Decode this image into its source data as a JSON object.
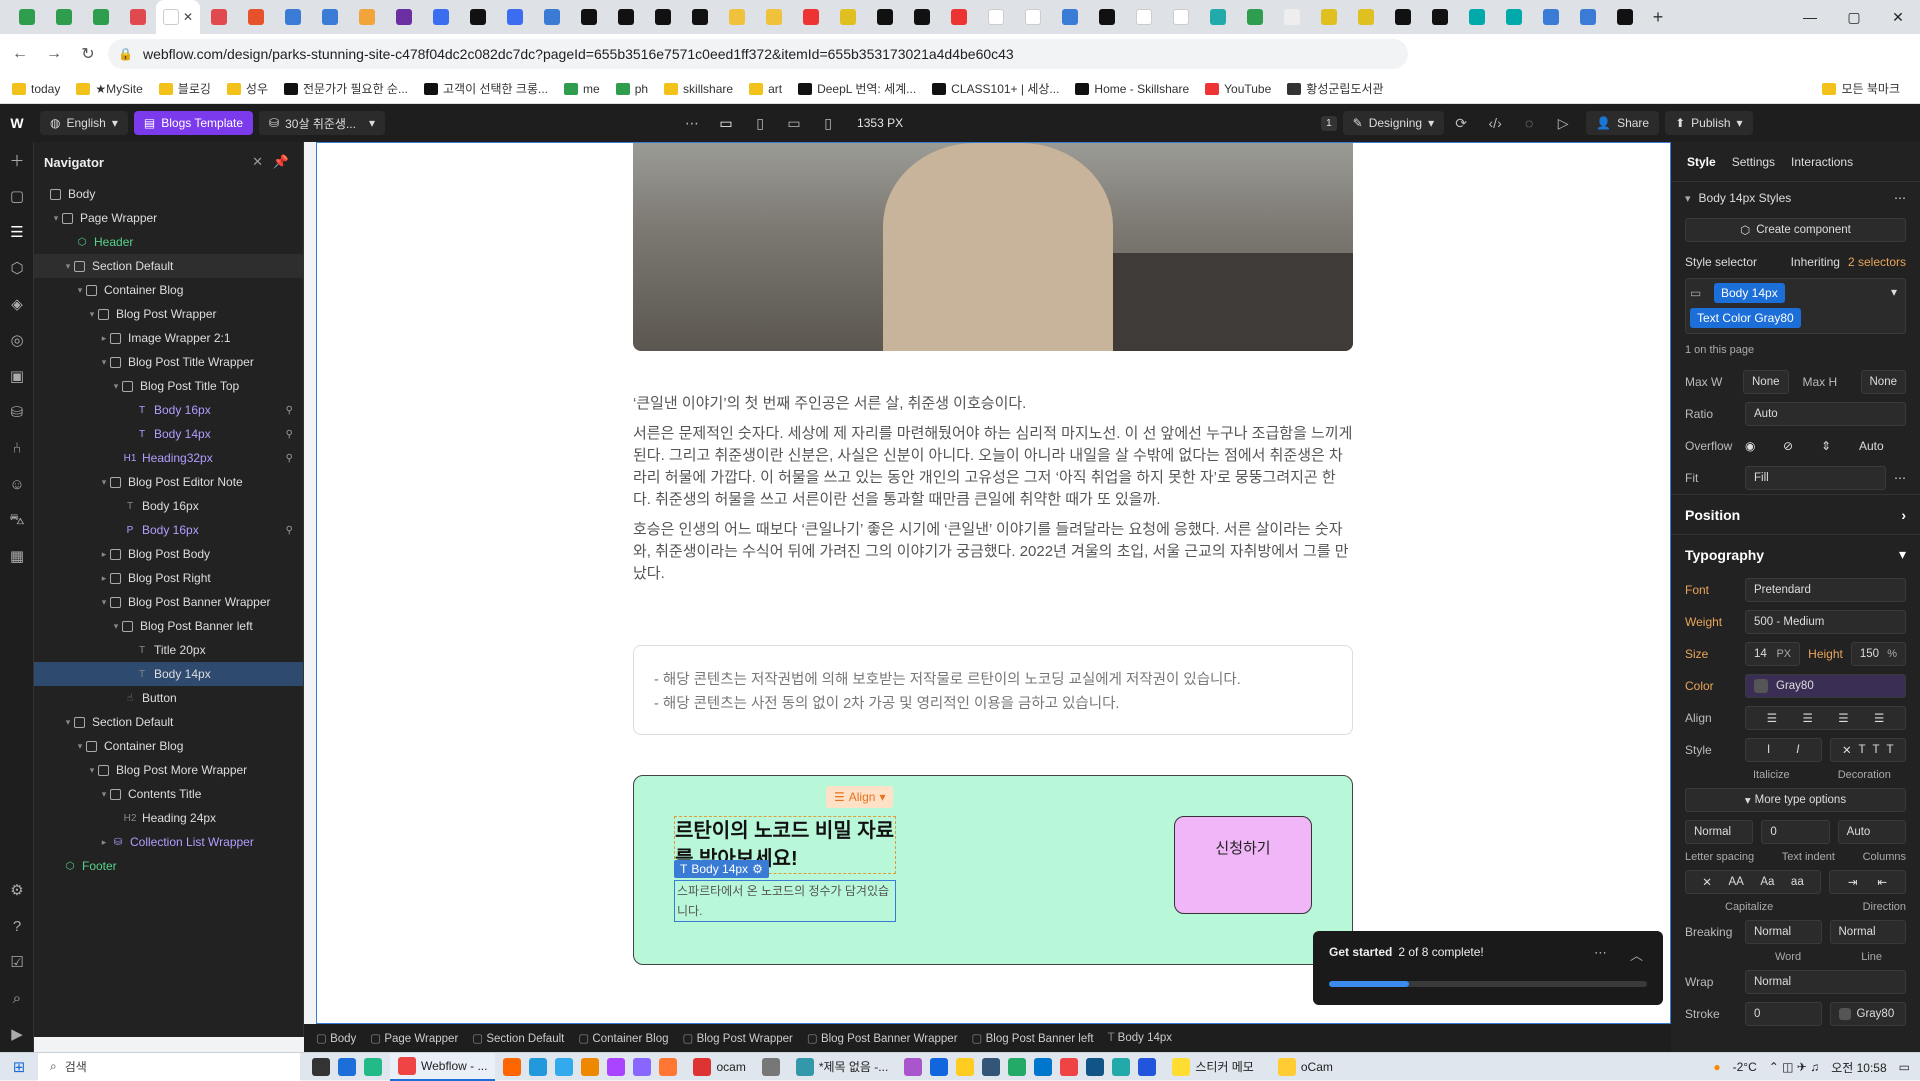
{
  "browser": {
    "active_tab_close": "✕",
    "new_tab": "+",
    "url": "webflow.com/design/parks-stunning-site-c478f04dc2c082dc7dc?pageId=655b3516e7571c0eed1ff372&itemId=655b353173021a4d4be60c43",
    "bookmarks": [
      "today",
      "★MySite",
      "블로깅",
      "성우",
      "전문가가 필요한 순...",
      "고객이 선택한 크롱...",
      "me",
      "ph",
      "skillshare",
      "art",
      "DeepL 번역: 세계...",
      "CLASS101+ | 세상...",
      "Home - Skillshare",
      "YouTube",
      "황성군립도서관"
    ],
    "bookmarks_more": "모든 북마크"
  },
  "wf_toolbar": {
    "locale": "English",
    "page": "Blogs Template",
    "collection": "30살 취준생...",
    "width": "1353 PX",
    "mode": "Designing",
    "share": "Share",
    "publish": "Publish",
    "badge": "1"
  },
  "navigator": {
    "title": "Navigator",
    "items": [
      {
        "label": "Body",
        "depth": 0,
        "caret": "",
        "kind": "box",
        "style": ""
      },
      {
        "label": "Page Wrapper",
        "depth": 1,
        "caret": "▾",
        "kind": "box",
        "style": ""
      },
      {
        "label": "Header",
        "depth": 2,
        "caret": "",
        "kind": "comp",
        "style": "green"
      },
      {
        "label": "Section Default",
        "depth": 2,
        "caret": "▾",
        "kind": "box",
        "style": "hov"
      },
      {
        "label": "Container Blog",
        "depth": 3,
        "caret": "▾",
        "kind": "box",
        "style": ""
      },
      {
        "label": "Blog Post Wrapper",
        "depth": 4,
        "caret": "▾",
        "kind": "box",
        "style": ""
      },
      {
        "label": "Image Wrapper 2:1",
        "depth": 5,
        "caret": "▸",
        "kind": "box",
        "style": ""
      },
      {
        "label": "Blog Post Title Wrapper",
        "depth": 5,
        "caret": "▾",
        "kind": "box",
        "style": ""
      },
      {
        "label": "Blog Post Title Top",
        "depth": 6,
        "caret": "▾",
        "kind": "box",
        "style": ""
      },
      {
        "label": "Body 16px",
        "depth": 7,
        "caret": "",
        "kind": "T",
        "style": "purple",
        "act": "⚲"
      },
      {
        "label": "Body 14px",
        "depth": 7,
        "caret": "",
        "kind": "T",
        "style": "purple",
        "act": "⚲"
      },
      {
        "label": "Heading32px",
        "depth": 6,
        "caret": "",
        "kind": "H1",
        "style": "purple",
        "act": "⚲"
      },
      {
        "label": "Blog Post Editor Note",
        "depth": 5,
        "caret": "▾",
        "kind": "box",
        "style": ""
      },
      {
        "label": "Body 16px",
        "depth": 6,
        "caret": "",
        "kind": "T",
        "style": ""
      },
      {
        "label": "Body 16px",
        "depth": 6,
        "caret": "",
        "kind": "P",
        "style": "purple",
        "act": "⚲"
      },
      {
        "label": "Blog Post Body",
        "depth": 5,
        "caret": "▸",
        "kind": "box",
        "style": ""
      },
      {
        "label": "Blog Post Right",
        "depth": 5,
        "caret": "▸",
        "kind": "box",
        "style": ""
      },
      {
        "label": "Blog Post Banner Wrapper",
        "depth": 5,
        "caret": "▾",
        "kind": "box",
        "style": ""
      },
      {
        "label": "Blog Post Banner left",
        "depth": 6,
        "caret": "▾",
        "kind": "box",
        "style": ""
      },
      {
        "label": "Title 20px",
        "depth": 7,
        "caret": "",
        "kind": "T",
        "style": ""
      },
      {
        "label": "Body 14px",
        "depth": 7,
        "caret": "",
        "kind": "T",
        "style": "sel"
      },
      {
        "label": "Button",
        "depth": 6,
        "caret": "",
        "kind": "btn",
        "style": ""
      },
      {
        "label": "Section Default",
        "depth": 2,
        "caret": "▾",
        "kind": "box",
        "style": ""
      },
      {
        "label": "Container Blog",
        "depth": 3,
        "caret": "▾",
        "kind": "box",
        "style": ""
      },
      {
        "label": "Blog Post More Wrapper",
        "depth": 4,
        "caret": "▾",
        "kind": "box",
        "style": ""
      },
      {
        "label": "Contents Title",
        "depth": 5,
        "caret": "▾",
        "kind": "box",
        "style": ""
      },
      {
        "label": "Heading 24px",
        "depth": 6,
        "caret": "",
        "kind": "H2",
        "style": ""
      },
      {
        "label": "Collection List Wrapper",
        "depth": 5,
        "caret": "▸",
        "kind": "db",
        "style": "purple"
      },
      {
        "label": "Footer",
        "depth": 1,
        "caret": "",
        "kind": "comp",
        "style": "green"
      }
    ]
  },
  "article": {
    "p1": "‘큰일낸 이야기’의 첫 번째 주인공은 서른 살, 취준생 이호승이다.",
    "p2": "서른은 문제적인 숫자다. 세상에 제 자리를 마련해뒀어야 하는 심리적 마지노선. 이 선 앞에선 누구나 조급함을 느끼게 된다. 그리고 취준생이란 신분은, 사실은 신분이 아니다. 오늘이 아니라 내일을 살 수밖에 없다는 점에서 취준생은 차라리 허물에 가깝다. 이 허물을 쓰고 있는 동안 개인의 고유성은 그저 ‘아직 취업을 하지 못한 자’로 뭉뚱그려지곤 한다. 취준생의 허물을 쓰고 서른이란 선을 통과할 때만큼 큰일에 취약한 때가 또 있을까.",
    "p3": "호승은 인생의 어느 때보다 ‘큰일나기’ 좋은 시기에 ‘큰일낸’ 이야기를 들려달라는 요청에 응했다. 서른 살이라는 숫자와, 취준생이라는 수식어 뒤에 가려진 그의 이야기가 궁금했다. 2022년 겨울의 초입, 서울 근교의 자취방에서 그를 만났다."
  },
  "note": {
    "line1": "- 해당 콘텐츠는 저작권법에 의해 보호받는 저작물로 르탄이의 노코딩 교실에게 저작권이 있습니다.",
    "line2": "- 해당 콘텐츠는 사전 동의 없이 2차 가공 및 영리적인 이용을 금하고 있습니다."
  },
  "banner": {
    "align_tag": "Align",
    "title": "르탄이의 노코드 비밀 자료를 받아보세요!",
    "sel_tag": "Body 14px",
    "body": "스파르타에서 온 노코드의 정수가 담겨있습니다.",
    "button": "신청하기"
  },
  "get_started": {
    "title": "Get started",
    "progress_text": "2 of 8 complete!",
    "progress": 0.25
  },
  "breadcrumb": [
    "Body",
    "Page Wrapper",
    "Section Default",
    "Container Blog",
    "Blog Post Wrapper",
    "Blog Post Banner Wrapper",
    "Blog Post Banner left",
    "Body 14px"
  ],
  "style_panel": {
    "tabs": [
      "Style",
      "Settings",
      "Interactions"
    ],
    "styles_label": "Body 14px Styles",
    "create_component": "Create component",
    "selector_label": "Style selector",
    "inheriting": "Inheriting",
    "inheriting_count": "2 selectors",
    "chip1": "Body 14px",
    "chip2": "Text Color Gray80",
    "on_page": "1 on this page",
    "maxw_label": "Max W",
    "maxw": "None",
    "maxh_label": "Max H",
    "maxh": "None",
    "ratio_label": "Ratio",
    "ratio": "Auto",
    "overflow_label": "Overflow",
    "overflow_auto": "Auto",
    "fit_label": "Fit",
    "fit": "Fill",
    "position": "Position",
    "typography": "Typography",
    "font_label": "Font",
    "font": "Pretendard",
    "weight_label": "Weight",
    "weight": "500 - Medium",
    "size_label": "Size",
    "size": "14",
    "size_unit": "PX",
    "height_label": "Height",
    "height": "150",
    "height_unit": "%",
    "color_label": "Color",
    "color": "Gray80",
    "align_label": "Align",
    "style_label": "Style",
    "italicize": "Italicize",
    "decoration": "Decoration",
    "more_type": "More type options",
    "letter_spacing": "Letter spacing",
    "letter_spacing_val": "Normal",
    "text_indent": "Text indent",
    "text_indent_val": "0",
    "columns": "Columns",
    "columns_val": "Auto",
    "capitalize": "Capitalize",
    "direction": "Direction",
    "breaking_label": "Breaking",
    "word_val": "Normal",
    "line_val": "Normal",
    "word": "Word",
    "line": "Line",
    "wrap_label": "Wrap",
    "wrap": "Normal",
    "stroke_label": "Stroke",
    "stroke_val": "0",
    "stroke_color": "Gray80"
  },
  "taskbar": {
    "search": "검색",
    "apps": [
      "Webflow - ...",
      "ocam",
      "*제목 없음 -...",
      "스티커 메모",
      "oCam"
    ],
    "temp": "-2°C",
    "time": "오전 10:58"
  }
}
